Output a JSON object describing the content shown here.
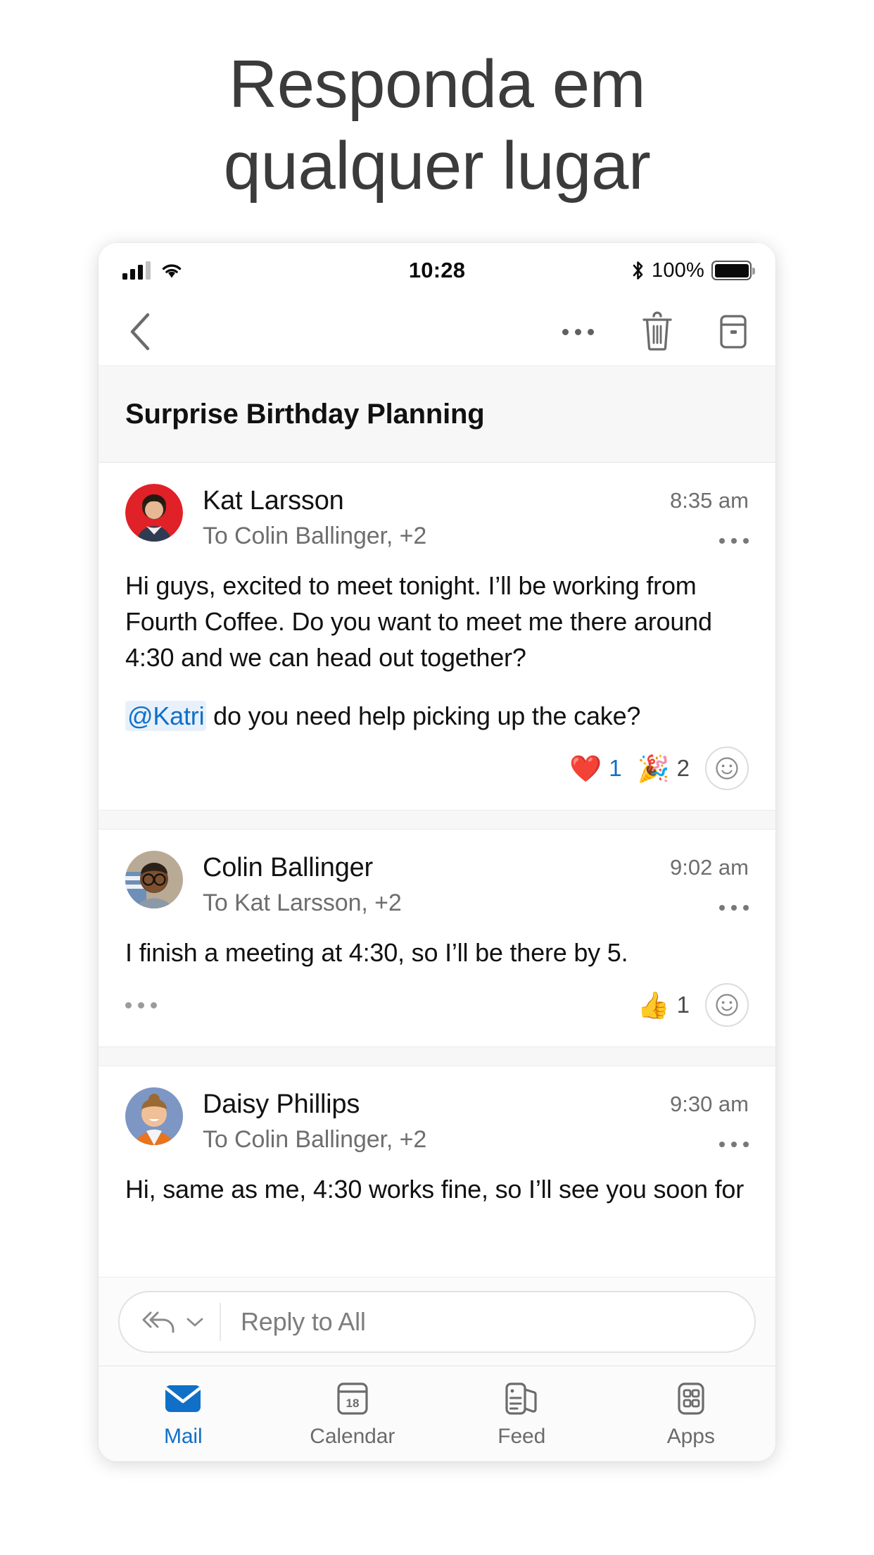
{
  "headline": {
    "line1": "Responda em",
    "line2": "qualquer lugar"
  },
  "colors": {
    "accent": "#1070c8",
    "mention_text": "#1070c8",
    "mention_bg": "#e8f1fb",
    "heart": "#e8262a",
    "subject_band": "#f7f7f7",
    "text_primary": "#111111",
    "text_secondary": "#6e6e6e"
  },
  "statusbar": {
    "time": "10:28",
    "battery_percent": "100%",
    "signal_icon": "signal-bars-icon",
    "wifi_icon": "wifi-icon",
    "bluetooth_icon": "bluetooth-icon",
    "battery_icon": "battery-full-icon"
  },
  "toolbar": {
    "back_icon": "back-chevron-icon",
    "more_icon": "more-horizontal-icon",
    "delete_icon": "trash-icon",
    "archive_icon": "archive-icon"
  },
  "subject": {
    "title": "Surprise Birthday Planning"
  },
  "messages": [
    {
      "sender": "Kat Larsson",
      "recipients": "To Colin Ballinger, +2",
      "time": "8:35 am",
      "kebab_icon": "more-horizontal-icon",
      "body_p1": "Hi guys, excited to meet tonight. I’ll be working from Fourth Coffee. Do you want to meet me there around 4:30 and we can head out together?",
      "mention": "@Katri",
      "body_p2": " do you need help picking up the cake?",
      "reactions": [
        {
          "emoji": "❤️",
          "name": "heart-reaction",
          "count": "1",
          "mine": true
        },
        {
          "emoji": "🎉",
          "name": "party-popper-reaction",
          "count": "2",
          "mine": false
        }
      ],
      "add_reaction_icon": "add-reaction-smiley-icon",
      "has_foot_more": false
    },
    {
      "sender": "Colin Ballinger",
      "recipients": "To Kat Larsson, +2",
      "time": "9:02 am",
      "kebab_icon": "more-horizontal-icon",
      "body_p1": "I finish a meeting at 4:30, so I’ll be there by 5.",
      "reactions": [
        {
          "emoji": "👍",
          "name": "thumbs-up-reaction",
          "count": "1",
          "mine": false
        }
      ],
      "add_reaction_icon": "add-reaction-smiley-icon",
      "has_foot_more": true
    },
    {
      "sender": "Daisy Phillips",
      "recipients": "To Colin Ballinger, +2",
      "time": "9:30 am",
      "kebab_icon": "more-horizontal-icon",
      "body_p1": "Hi, same as me, 4:30 works fine, so I’ll see you soon for"
    }
  ],
  "reply": {
    "placeholder": "Reply to All",
    "reply_all_icon": "reply-all-icon",
    "chevron_icon": "chevron-down-icon"
  },
  "tabs": [
    {
      "label": "Mail",
      "icon": "mail-icon",
      "active": true
    },
    {
      "label": "Calendar",
      "icon": "calendar-icon",
      "active": false
    },
    {
      "label": "Feed",
      "icon": "feed-icon",
      "active": false
    },
    {
      "label": "Apps",
      "icon": "apps-grid-icon",
      "active": false
    }
  ],
  "calendar_icon_day": "18"
}
